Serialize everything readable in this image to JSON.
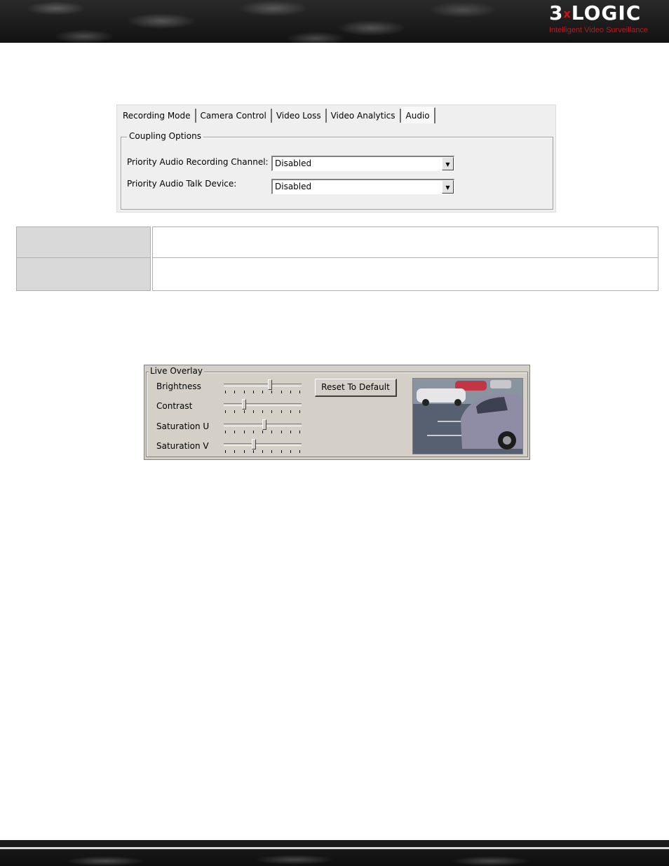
{
  "header": {
    "logo_main_a": "3",
    "logo_main_x": "x",
    "logo_main_b": "LOGIC",
    "logo_tagline": "Intelligent Video Surveillance"
  },
  "dialog_audio": {
    "tabs": [
      {
        "label": "Recording Mode",
        "active": false
      },
      {
        "label": "Camera Control",
        "active": false
      },
      {
        "label": "Video Loss",
        "active": false
      },
      {
        "label": "Video Analytics",
        "active": false
      },
      {
        "label": "Audio",
        "active": true
      }
    ],
    "group_title": "Coupling Options",
    "rows": [
      {
        "label": "Priority Audio Recording Channel:",
        "value": "Disabled"
      },
      {
        "label": "Priority Audio Talk Device:",
        "value": "Disabled"
      }
    ]
  },
  "table": {
    "rows": [
      {
        "header": "",
        "description": ""
      },
      {
        "header": "",
        "description": ""
      }
    ]
  },
  "dialog_overlay": {
    "group_title": "Live Overlay",
    "sliders": [
      {
        "label": "Brightness",
        "value": 0.6
      },
      {
        "label": "Contrast",
        "value": 0.25
      },
      {
        "label": "Saturation U",
        "value": 0.52
      },
      {
        "label": "Saturation V",
        "value": 0.38
      }
    ],
    "reset_label": "Reset To Default",
    "preview_icon": "camera-preview-image"
  },
  "colors": {
    "brand_red": "#d0121b",
    "dialog_bg": "#efefef",
    "classic_bg": "#d4d0c8"
  }
}
